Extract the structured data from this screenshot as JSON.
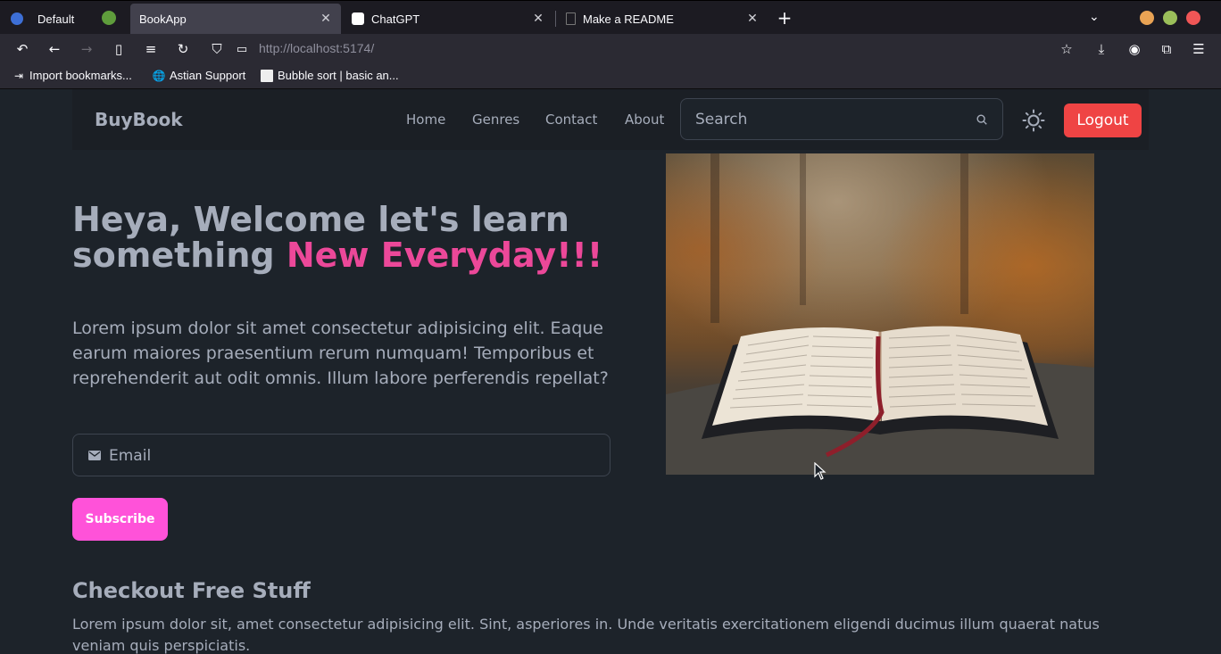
{
  "browser": {
    "tabs": [
      {
        "label": "Default",
        "active": false
      },
      {
        "label": "BookApp",
        "active": true
      },
      {
        "label": "ChatGPT",
        "active": false
      },
      {
        "label": "Make a README",
        "active": false
      }
    ],
    "url_host": "http://localhost",
    "url_port": ":5174/",
    "bookmarks": [
      "Import bookmarks...",
      "Astian Support",
      "Bubble sort | basic an..."
    ],
    "colors": {
      "close": "#f05656",
      "maximize": "#9bbf5a",
      "minimize": "#e9a354"
    }
  },
  "site": {
    "brand": "BuyBook",
    "menu": [
      "Home",
      "Genres",
      "Contact",
      "About"
    ],
    "search_placeholder": "Search",
    "logout_label": "Logout"
  },
  "hero": {
    "title_part1": "Heya, Welcome let's learn something ",
    "title_accent": "New Everyday!!!",
    "text": "Lorem ipsum dolor sit amet consectetur adipisicing elit. Eaque earum maiores praesentium rerum numquam! Temporibus et reprehenderit aut odit omnis. Illum labore perferendis repellat?",
    "email_placeholder": "Email",
    "subscribe_label": "Subscribe"
  },
  "free_stuff": {
    "title": "Checkout Free Stuff",
    "text": "Lorem ipsum dolor sit, amet consectetur adipisicing elit. Sint, asperiores in. Unde veritatis exercitationem eligendi ducimus illum quaerat natus veniam quis perspiciatis."
  },
  "colors": {
    "accent_pink": "#ec4899",
    "subscribe_bg": "#ff52d9",
    "logout_bg": "#ef4444",
    "page_bg": "#1d232a"
  }
}
